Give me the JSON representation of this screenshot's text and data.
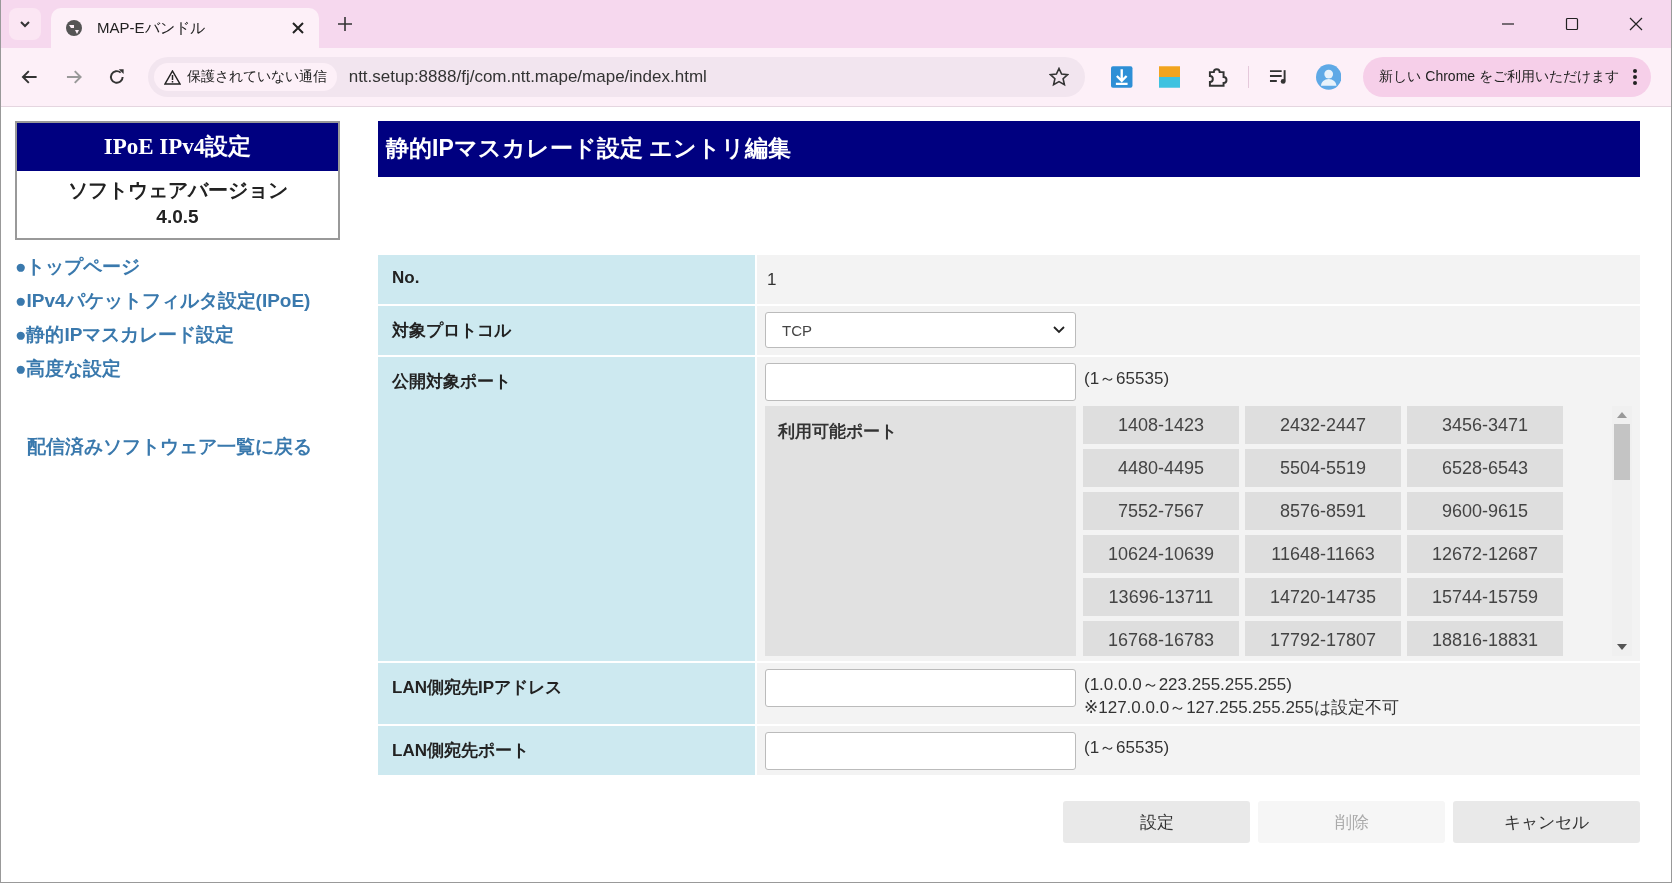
{
  "browser": {
    "tab_title": "MAP-Eバンドル",
    "security_label": "保護されていない通信",
    "url": "ntt.setup:8888/fj/com.ntt.mape/mape/index.html",
    "update_button": "新しい Chrome をご利用いただけます"
  },
  "sidebar": {
    "title": "IPoE IPv4設定",
    "version_label": "ソフトウェアバージョン",
    "version": "4.0.5",
    "links": [
      "●トップページ",
      "●IPv4パケットフィルタ設定(IPoE)",
      "●静的IPマスカレード設定",
      "●高度な設定"
    ],
    "back_link": "配信済みソフトウェア一覧に戻る"
  },
  "main": {
    "title": "静的IPマスカレード設定 エントリ編集",
    "form": [
      {
        "kind": "text",
        "label": "No.",
        "value": "1"
      },
      {
        "kind": "select",
        "label": "対象プロトコル",
        "value": "TCP"
      },
      {
        "kind": "ports",
        "label": "公開対象ポート",
        "hints": [
          "(1～65535)"
        ],
        "available_label": "利用可能ポート",
        "ports": [
          "1408-1423",
          "2432-2447",
          "3456-3471",
          "4480-4495",
          "5504-5519",
          "6528-6543",
          "7552-7567",
          "8576-8591",
          "9600-9615",
          "10624-10639",
          "11648-11663",
          "12672-12687",
          "13696-13711",
          "14720-14735",
          "15744-15759",
          "16768-16783",
          "17792-17807",
          "18816-18831"
        ]
      },
      {
        "kind": "input",
        "label": "LAN側宛先IPアドレス",
        "hints": [
          "(1.0.0.0～223.255.255.255)",
          "※127.0.0.0～127.255.255.255は設定不可"
        ]
      },
      {
        "kind": "input",
        "label": "LAN側宛先ポート",
        "hints": [
          "(1～65535)"
        ]
      }
    ],
    "buttons": [
      {
        "label": "設定",
        "disabled": false
      },
      {
        "label": "削除",
        "disabled": true
      },
      {
        "label": "キャンセル",
        "disabled": false
      }
    ]
  }
}
